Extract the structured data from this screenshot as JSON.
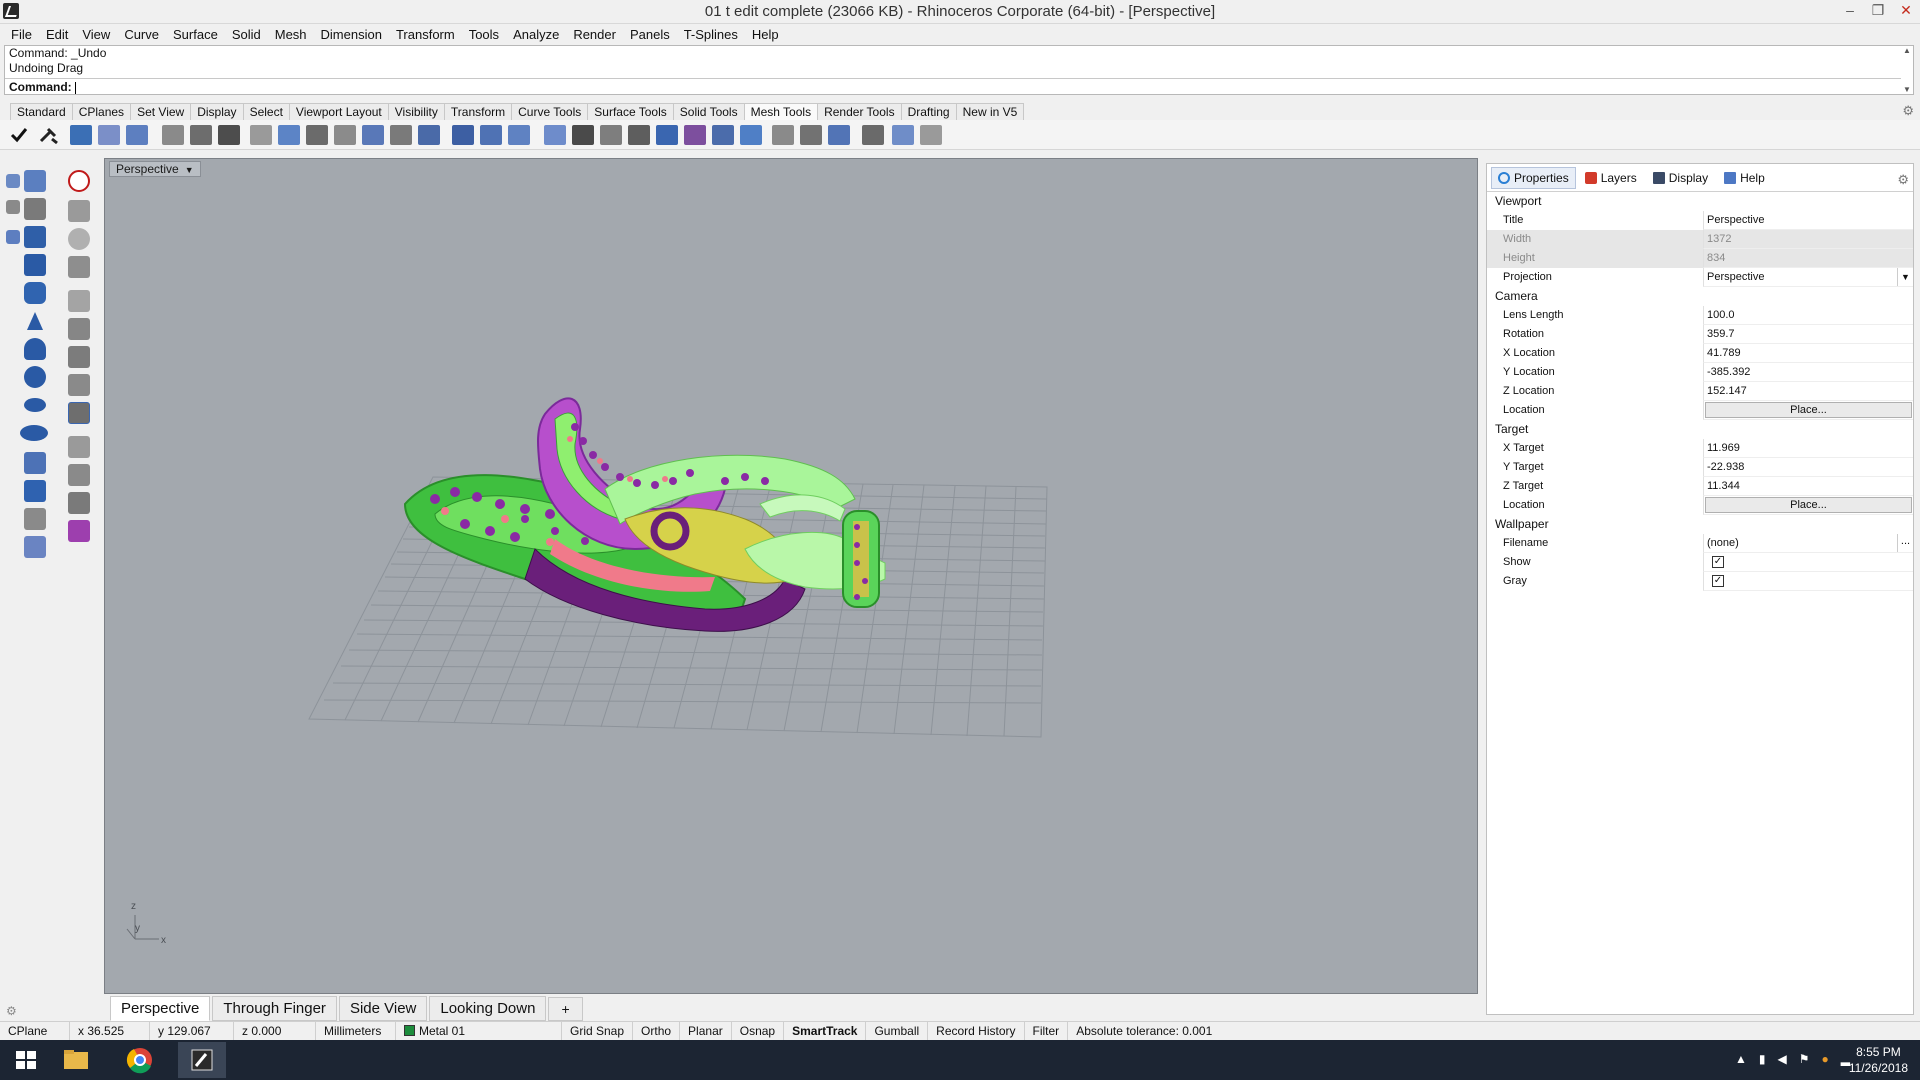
{
  "window": {
    "title": "01 t edit complete (23066 KB) - Rhinoceros Corporate (64-bit) - [Perspective]",
    "min": "–",
    "max": "❐",
    "close": "✕"
  },
  "menu": [
    "File",
    "Edit",
    "View",
    "Curve",
    "Surface",
    "Solid",
    "Mesh",
    "Dimension",
    "Transform",
    "Tools",
    "Analyze",
    "Render",
    "Panels",
    "T-Splines",
    "Help"
  ],
  "command": {
    "history": [
      "Command: _Undo",
      "Undoing Drag"
    ],
    "prompt": "Command:"
  },
  "toolbar_tabs": [
    "Standard",
    "CPlanes",
    "Set View",
    "Display",
    "Select",
    "Viewport Layout",
    "Visibility",
    "Transform",
    "Curve Tools",
    "Surface Tools",
    "Solid Tools",
    "Mesh Tools",
    "Render Tools",
    "Drafting",
    "New in V5"
  ],
  "active_toolbar_tab": "Mesh Tools",
  "viewport": {
    "title": "Perspective",
    "axis_x": "x",
    "axis_y": "y",
    "axis_z": "z"
  },
  "viewport_tabs": [
    "Perspective",
    "Through Finger",
    "Side View",
    "Looking Down"
  ],
  "viewport_tab_add": "+",
  "panel": {
    "tabs": [
      {
        "label": "Properties",
        "color": "#2a7fd4"
      },
      {
        "label": "Layers",
        "color": "#d23a2a"
      },
      {
        "label": "Display",
        "color": "#3a4a66"
      },
      {
        "label": "Help",
        "color": "#4d78c4"
      }
    ],
    "sections": {
      "viewport": "Viewport",
      "camera": "Camera",
      "target": "Target",
      "wallpaper": "Wallpaper"
    },
    "viewport_rows": {
      "title": {
        "label": "Title",
        "value": "Perspective"
      },
      "width": {
        "label": "Width",
        "value": "1372"
      },
      "height": {
        "label": "Height",
        "value": "834"
      },
      "projection": {
        "label": "Projection",
        "value": "Perspective"
      }
    },
    "camera_rows": {
      "lens": {
        "label": "Lens Length",
        "value": "100.0"
      },
      "rotation": {
        "label": "Rotation",
        "value": "359.7"
      },
      "xloc": {
        "label": "X Location",
        "value": "41.789"
      },
      "yloc": {
        "label": "Y Location",
        "value": "-385.392"
      },
      "zloc": {
        "label": "Z Location",
        "value": "152.147"
      },
      "location": {
        "label": "Location",
        "value": "Place..."
      }
    },
    "target_rows": {
      "x": {
        "label": "X Target",
        "value": "11.969"
      },
      "y": {
        "label": "Y Target",
        "value": "-22.938"
      },
      "z": {
        "label": "Z Target",
        "value": "11.344"
      },
      "location": {
        "label": "Location",
        "value": "Place..."
      }
    },
    "wallpaper_rows": {
      "filename": {
        "label": "Filename",
        "value": "(none)",
        "button": "..."
      },
      "show": {
        "label": "Show",
        "checked": true
      },
      "gray": {
        "label": "Gray",
        "checked": true
      }
    },
    "check_mark": "✓"
  },
  "status": {
    "cplane": "CPlane",
    "x": "x 36.525",
    "y": "y 129.067",
    "z": "z 0.000",
    "units": "Millimeters",
    "layer": "Metal 01",
    "layer_color": "#1c8c3c",
    "toggles": [
      "Grid Snap",
      "Ortho",
      "Planar",
      "Osnap",
      "SmartTrack",
      "Gumball",
      "Record History",
      "Filter"
    ],
    "bold_toggle": "SmartTrack",
    "tolerance": "Absolute tolerance: 0.001"
  },
  "taskbar": {
    "time": "8:55 PM",
    "date": "11/26/2018"
  }
}
